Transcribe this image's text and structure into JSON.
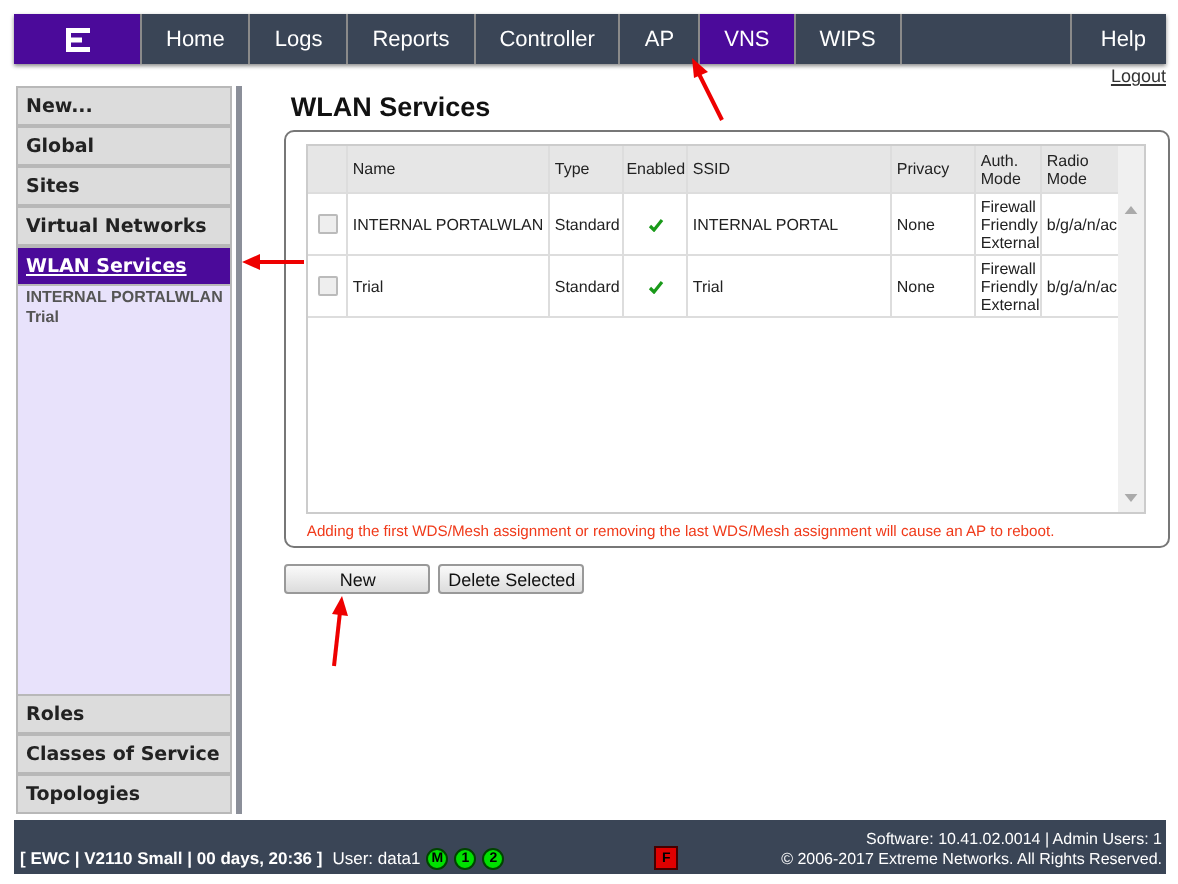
{
  "nav": {
    "tabs": [
      {
        "label": "Home",
        "selected": false
      },
      {
        "label": "Logs",
        "selected": false
      },
      {
        "label": "Reports",
        "selected": false
      },
      {
        "label": "Controller",
        "selected": false
      },
      {
        "label": "AP",
        "selected": false
      },
      {
        "label": "VNS",
        "selected": true
      },
      {
        "label": "WIPS",
        "selected": false
      }
    ],
    "help": "Help",
    "logout": "Logout"
  },
  "sidebar": {
    "top_items": [
      {
        "label": "New...",
        "selected": false
      },
      {
        "label": "Global",
        "selected": false
      },
      {
        "label": "Sites",
        "selected": false
      },
      {
        "label": "Virtual Networks",
        "selected": false
      },
      {
        "label": "WLAN Services",
        "selected": true
      }
    ],
    "sub_items": [
      "INTERNAL PORTALWLAN",
      "Trial"
    ],
    "bottom_items": [
      {
        "label": "Roles",
        "selected": false
      },
      {
        "label": "Classes of Service",
        "selected": false
      },
      {
        "label": "Topologies",
        "selected": false
      }
    ]
  },
  "page_title": "WLAN Services",
  "table": {
    "columns": [
      "Name",
      "Type",
      "Enabled",
      "SSID",
      "Privacy",
      "Auth. Mode",
      "Radio Mode"
    ],
    "rows": [
      {
        "checked": false,
        "name": "INTERNAL PORTALWLAN",
        "type": "Standard",
        "enabled": true,
        "ssid": "INTERNAL PORTAL",
        "privacy": "None",
        "auth_mode": "Firewall Friendly External",
        "radio_mode": "b/g/a/n/ac"
      },
      {
        "checked": false,
        "name": "Trial",
        "type": "Standard",
        "enabled": true,
        "ssid": "Trial",
        "privacy": "None",
        "auth_mode": "Firewall Friendly External",
        "radio_mode": "b/g/a/n/ac"
      }
    ]
  },
  "warning": "Adding the first WDS/Mesh assignment or removing the last WDS/Mesh assignment will cause an AP to reboot.",
  "buttons": [
    "New",
    "Delete Selected"
  ],
  "status_bar": {
    "system": "[ EWC | V2110 Small | 00 days, 20:36 ]",
    "user": "User: data1",
    "indicators": [
      {
        "label": "M",
        "color": "#00e000"
      },
      {
        "label": "1",
        "color": "#00e000"
      },
      {
        "label": "2",
        "color": "#00e000"
      }
    ],
    "alarm": {
      "label": "F",
      "color": "#e00000"
    },
    "software": "Software: 10.41.02.0014 | Admin Users: 1",
    "copyright": "© 2006-2017  Extreme Networks. All Rights Reserved."
  }
}
